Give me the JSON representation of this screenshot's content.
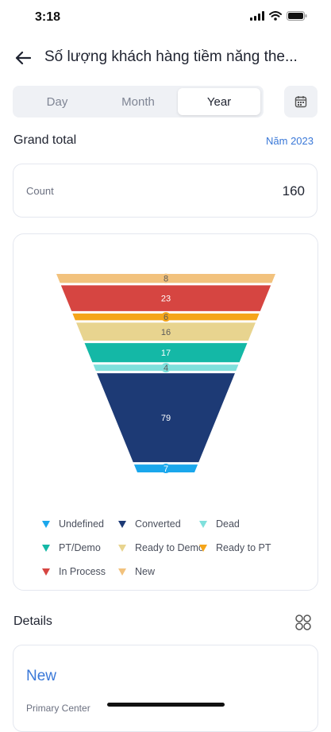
{
  "status_bar": {
    "time": "3:18",
    "icons": [
      "signal-icon",
      "wifi-icon",
      "battery-icon"
    ]
  },
  "header": {
    "title": "Số lượng khách hàng tiềm năng the...",
    "back_icon": "arrow-left-icon"
  },
  "period_tabs": [
    {
      "label": "Day",
      "active": false
    },
    {
      "label": "Month",
      "active": false
    },
    {
      "label": "Year",
      "active": true
    }
  ],
  "calendar_icon": "calendar-icon",
  "grand_total": {
    "title": "Grand total",
    "period_label": "Năm 2023"
  },
  "count_card": {
    "label": "Count",
    "value": "160"
  },
  "chart_data": {
    "type": "funnel",
    "stages": [
      {
        "name": "New",
        "value": 8,
        "color": "#f2c27d"
      },
      {
        "name": "In Process",
        "value": 23,
        "color": "#d64541"
      },
      {
        "name": "Ready to PT",
        "value": 6,
        "color": "#f5a51a"
      },
      {
        "name": "Ready to Demo",
        "value": 16,
        "color": "#e8d48f"
      },
      {
        "name": "PT/Demo",
        "value": 17,
        "color": "#14b8a6"
      },
      {
        "name": "Dead",
        "value": 4,
        "color": "#7fe0dc"
      },
      {
        "name": "Converted",
        "value": 79,
        "color": "#1d3a75"
      },
      {
        "name": "Undefined",
        "value": 7,
        "color": "#1aa7ec"
      }
    ],
    "legend_order": [
      "Undefined",
      "Converted",
      "Dead",
      "PT/Demo",
      "Ready to Demo",
      "Ready to PT",
      "In Process",
      "New"
    ]
  },
  "details": {
    "title": "Details",
    "grid_icon": "grid-icon"
  },
  "detail_card": {
    "title": "New",
    "subtitle": "Primary Center"
  }
}
